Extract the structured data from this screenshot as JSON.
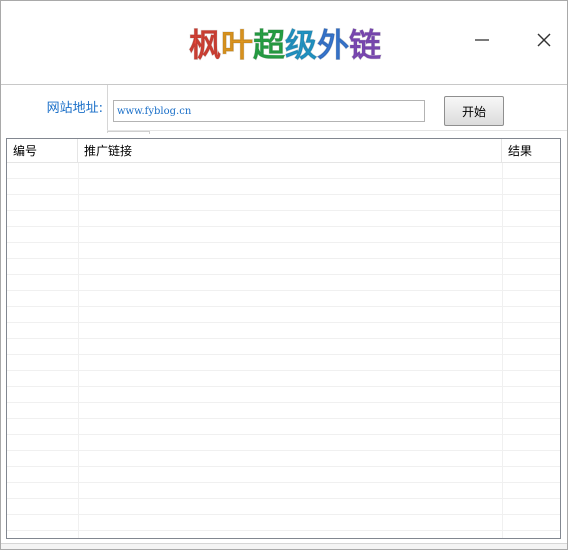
{
  "window": {
    "title_chars": [
      {
        "ch": "枫",
        "color": "#e8473a"
      },
      {
        "ch": "叶",
        "color": "#f2a422"
      },
      {
        "ch": "超",
        "color": "#2bb24c"
      },
      {
        "ch": "级",
        "color": "#25a3d8"
      },
      {
        "ch": "外",
        "color": "#3b7fe0"
      },
      {
        "ch": "链",
        "color": "#8a52c9"
      }
    ],
    "minimize_icon": "minimize-icon",
    "close_icon": "close-icon"
  },
  "form": {
    "url_label": "网站地址:",
    "url_value": "www.fyblog.cn",
    "start_label": "开始"
  },
  "table": {
    "columns": [
      "编号",
      "推广链接",
      "结果"
    ],
    "rows": []
  },
  "colors": {
    "label_blue": "#1a6fc8",
    "input_text_blue": "#1a6fc8"
  }
}
